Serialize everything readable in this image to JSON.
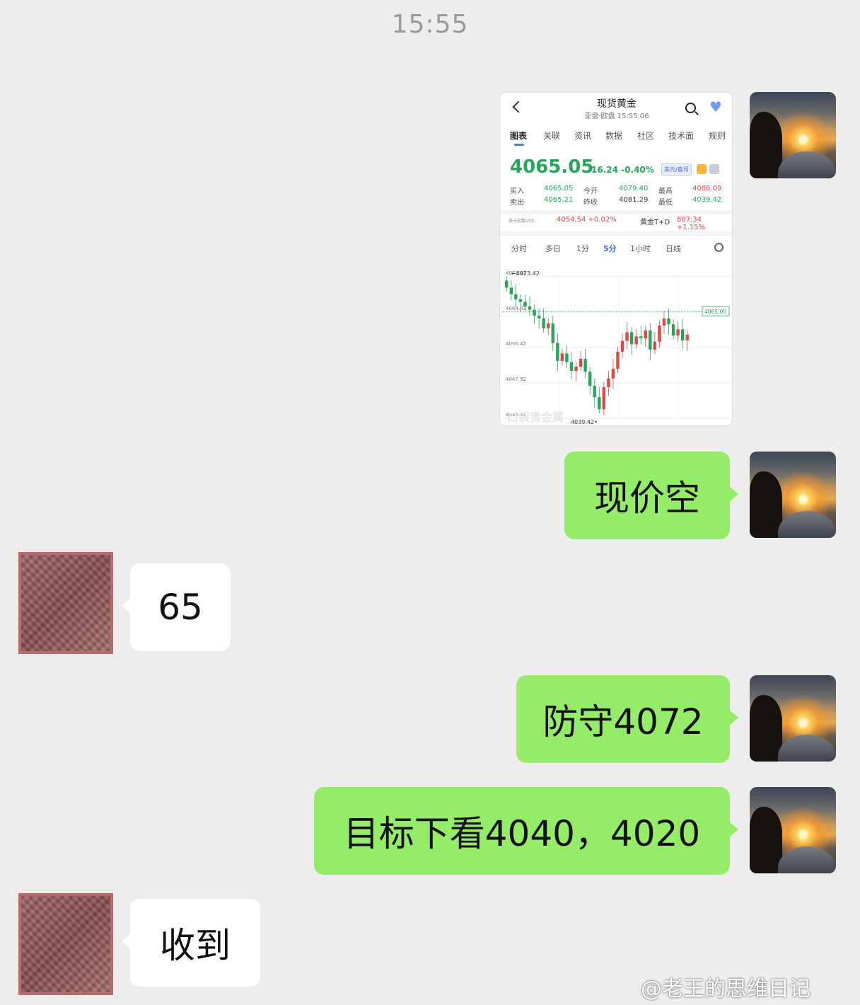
{
  "timestamp": "15:55",
  "shared_screenshot": {
    "title": "现货黄金",
    "subtitle": "亚盘·欧盘   15:55:06",
    "tabs": [
      "图表",
      "关联",
      "资讯",
      "数据",
      "社区",
      "技术面",
      "规则"
    ],
    "active_tab": "图表",
    "price": "4065.05",
    "change": "-16.24  -0.40%",
    "currency_badge": "美元/盎司",
    "quotes": {
      "buy_label": "买入",
      "buy": "4065.05",
      "sell_label": "卖出",
      "sell": "4065.21",
      "open_label": "今开",
      "open": "4079.40",
      "prev_close_label": "昨收",
      "prev_close": "4081.29",
      "high_label": "最高",
      "high": "4086.09",
      "low_label": "最低",
      "low": "4039.42"
    },
    "ref_left_label": "美元指数USD",
    "ref_left_value": "4054.54 +0.02%",
    "ref_right_label": "黄金T+D",
    "ref_right_value": "887.34 +1.15%",
    "period_tabs": [
      "分时",
      "多日",
      "1分",
      "5分",
      "1小时",
      "日线"
    ],
    "active_period": "5分",
    "colors": {
      "up": "#e04848",
      "down": "#26a65b",
      "accent": "#3b6fd8"
    },
    "chart_data": {
      "type": "candlestick",
      "ylim": [
        4039.42,
        4073.42
      ],
      "y_ticks": [
        "4073.42",
        "4064.92",
        "4056.42",
        "4047.92",
        "4039.42"
      ],
      "current_line": "4065.05",
      "max_label": "4073.42",
      "min_label": "4039.42",
      "watermark": "口袋贵金属",
      "close": [
        4070.8,
        4069.2,
        4068.0,
        4067.4,
        4066.3,
        4065.5,
        4064.1,
        4063.4,
        4061.0,
        4062.2,
        4057.5,
        4053.2,
        4055.0,
        4052.9,
        4050.8,
        4051.8,
        4053.7,
        4050.6,
        4047.2,
        4044.5,
        4041.6,
        4046.9,
        4049.0,
        4051.3,
        4055.4,
        4058.0,
        4060.1,
        4057.2,
        4059.1,
        4058.6,
        4060.5,
        4055.9,
        4057.8,
        4061.7,
        4063.4,
        4062.0,
        4059.3,
        4060.8,
        4058.1,
        4059.5
      ],
      "open": [
        4072.5,
        4070.8,
        4069.2,
        4068.0,
        4067.4,
        4066.3,
        4065.5,
        4064.1,
        4063.4,
        4061.0,
        4062.2,
        4057.5,
        4053.2,
        4055.0,
        4052.9,
        4050.8,
        4051.8,
        4053.7,
        4050.6,
        4047.2,
        4044.5,
        4041.6,
        4046.9,
        4049.0,
        4051.3,
        4055.4,
        4058.0,
        4060.1,
        4057.2,
        4059.1,
        4058.6,
        4060.5,
        4055.9,
        4057.8,
        4061.7,
        4063.4,
        4062.0,
        4059.3,
        4060.8,
        4058.1
      ]
    }
  },
  "messages": [
    {
      "sender": "self",
      "text": "现价空"
    },
    {
      "sender": "other",
      "text": "65"
    },
    {
      "sender": "self",
      "text": "防守4072"
    },
    {
      "sender": "self",
      "text": "目标下看4040，4020"
    },
    {
      "sender": "other",
      "text": "收到"
    }
  ],
  "watermark": "@老王的思维日记"
}
